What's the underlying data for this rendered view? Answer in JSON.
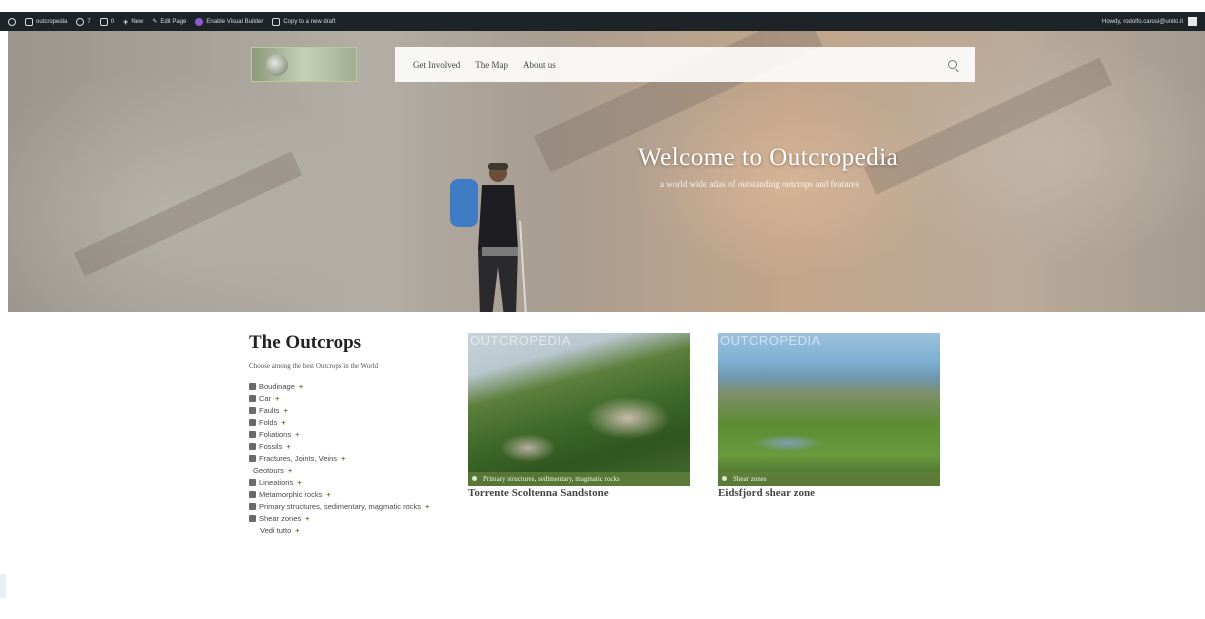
{
  "adminbar": {
    "site_name": "outcropedia",
    "updates": "7",
    "comments": "0",
    "new_label": "New",
    "edit_label": "Edit Page",
    "visual_builder": "Enable Visual Builder",
    "copy_draft": "Copy to a new draft",
    "howdy": "Howdy, rodolfo.carosi@unito.it"
  },
  "nav": {
    "items": [
      "Get Involved",
      "The Map",
      "About us"
    ]
  },
  "hero": {
    "title": "Welcome to Outcropedia",
    "subtitle": "a world wide atlas of outstanding outcrops and features"
  },
  "sidebar": {
    "title": "The Outcrops",
    "description": "Choose among the best Outcrops in the World",
    "categories": [
      {
        "label": "Boudinage"
      },
      {
        "label": "Car"
      },
      {
        "label": "Faults"
      },
      {
        "label": "Folds"
      },
      {
        "label": "Foliations"
      },
      {
        "label": "Fossils"
      },
      {
        "label": "Fractures, Joints, Veins"
      },
      {
        "label": "Geotours"
      },
      {
        "label": "Lineations"
      },
      {
        "label": "Metamorphic rocks"
      },
      {
        "label": "Primary structures, sedimentary, magmatic rocks"
      },
      {
        "label": "Shear zones"
      },
      {
        "label": "Vedi tutto"
      }
    ]
  },
  "cards": [
    {
      "watermark": "OUTCROPEDIA",
      "caption": "Primary structures, sedimentary, magmatic rocks",
      "title": "Torrente Scoltenna Sandstone"
    },
    {
      "watermark": "OUTCROPEDIA",
      "caption": "Shear zones",
      "title": "Eidsfjord shear zone"
    }
  ]
}
